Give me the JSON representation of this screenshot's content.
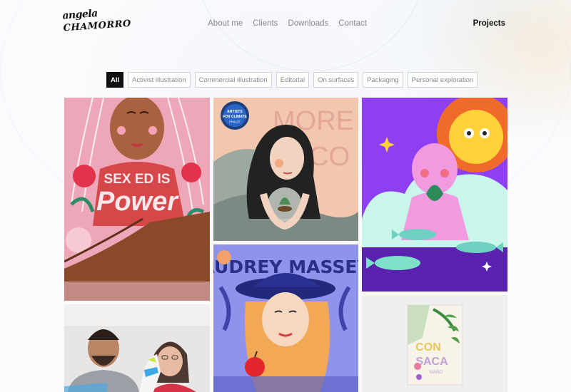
{
  "brand": {
    "logo_line1": "angela",
    "logo_line2": "CHAMORRO"
  },
  "nav": {
    "items": [
      "About me",
      "Clients",
      "Downloads",
      "Contact"
    ],
    "projects": "Projects"
  },
  "filters": {
    "items": [
      "All",
      "Activist illustration",
      "Commercial illustration",
      "Editorial",
      "On surfaces",
      "Packaging",
      "Personal exploration"
    ],
    "active": "All"
  },
  "gallery": {
    "tiles": [
      {
        "id": "sex-ed",
        "text": "SEX ED IS",
        "text2": "Power"
      },
      {
        "id": "more-eco",
        "text": "MORE",
        "text2": "ECO",
        "badge_line1": "ARTISTS",
        "badge_line2": "FOR CLIMATE",
        "badge_line3": "FINALIST"
      },
      {
        "id": "sun-fish",
        "text": ""
      },
      {
        "id": "sneakers-photo",
        "text": ""
      },
      {
        "id": "audrey",
        "text": "AUDREY MASSEY"
      },
      {
        "id": "book",
        "text": "CON",
        "text2": "SACA",
        "text3": "MAÑO"
      }
    ]
  },
  "colors": {
    "accent": "#111111",
    "pink_bg": "#e7a2b5",
    "peach_bg": "#f2c6b0",
    "purple_bg": "#8b3df0",
    "blue_bg": "#8c8fe8"
  }
}
